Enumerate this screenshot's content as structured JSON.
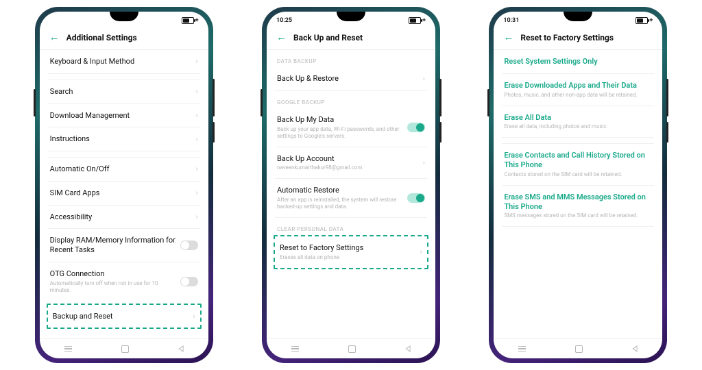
{
  "phone1": {
    "status_time": "",
    "header": "Additional Settings",
    "rows": {
      "keyboard": "Keyboard & Input Method",
      "search": "Search",
      "download": "Download Management",
      "instructions": "Instructions",
      "auto_onoff": "Automatic On/Off",
      "sim_apps": "SIM Card Apps",
      "accessibility": "Accessibility",
      "ram_title": "Display RAM/Memory Information for Recent Tasks",
      "otg_title": "OTG Connection",
      "otg_sub": "Automatically turn off when not in use for 10 minutes.",
      "backup_reset": "Backup and Reset"
    }
  },
  "phone2": {
    "status_time": "10:25",
    "header": "Back Up and Reset",
    "sections": {
      "data_backup": "DATA BACKUP",
      "google_backup": "GOOGLE BACKUP",
      "clear_personal": "CLEAR PERSONAL DATA"
    },
    "rows": {
      "backup_restore": "Back Up & Restore",
      "backup_my_data": "Back Up My Data",
      "backup_my_data_sub": "Back up your app data, Wi-Fi passwords, and other settings to Google's servers.",
      "backup_account": "Back Up Account",
      "backup_account_sub": "naveenkumarthakur98@gmail.com",
      "auto_restore": "Automatic Restore",
      "auto_restore_sub": "After an app is reinstalled, the system will restore backed-up settings and data.",
      "reset_factory": "Reset to Factory Settings",
      "reset_factory_sub": "Erases all data on phone"
    }
  },
  "phone3": {
    "status_time": "10:31",
    "header": "Reset to Factory Settings",
    "rows": {
      "reset_system": "Reset System Settings Only",
      "erase_apps": "Erase Downloaded Apps and Their Data",
      "erase_apps_sub": "Photos, music, and other non-app data will be retained.",
      "erase_all": "Erase All Data",
      "erase_all_sub": "Erase all data, including photos and music.",
      "erase_contacts": "Erase Contacts and Call History Stored on This Phone",
      "erase_contacts_sub": "Contacts stored on the SIM card will be retained.",
      "erase_sms": "Erase SMS and MMS Messages Stored on This Phone",
      "erase_sms_sub": "SMS messages stored on the SIM card will be retained."
    }
  }
}
